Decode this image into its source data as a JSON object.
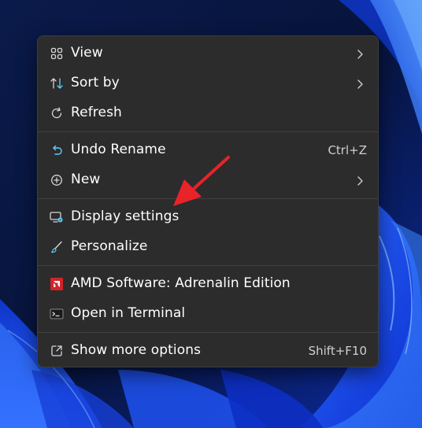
{
  "menu": {
    "items": [
      {
        "label": "View",
        "icon": "grid-view-icon",
        "submenu": true
      },
      {
        "label": "Sort by",
        "icon": "sort-arrows-icon",
        "submenu": true
      },
      {
        "label": "Refresh",
        "icon": "refresh-icon"
      },
      {
        "label": "Undo Rename",
        "icon": "undo-icon",
        "shortcut": "Ctrl+Z"
      },
      {
        "label": "New",
        "icon": "plus-circle-icon",
        "submenu": true
      },
      {
        "label": "Display settings",
        "icon": "display-settings-icon"
      },
      {
        "label": "Personalize",
        "icon": "paintbrush-icon"
      },
      {
        "label": "AMD Software: Adrenalin Edition",
        "icon": "amd-logo-icon"
      },
      {
        "label": "Open in Terminal",
        "icon": "terminal-icon"
      },
      {
        "label": "Show more options",
        "icon": "share-box-icon",
        "shortcut": "Shift+F10"
      }
    ]
  },
  "colors": {
    "menu_bg": "#2c2c2c",
    "text": "#ffffff",
    "accent_blue": "#60cdff",
    "arrow_red": "#e8232a",
    "amd_red": "#d2232a"
  }
}
